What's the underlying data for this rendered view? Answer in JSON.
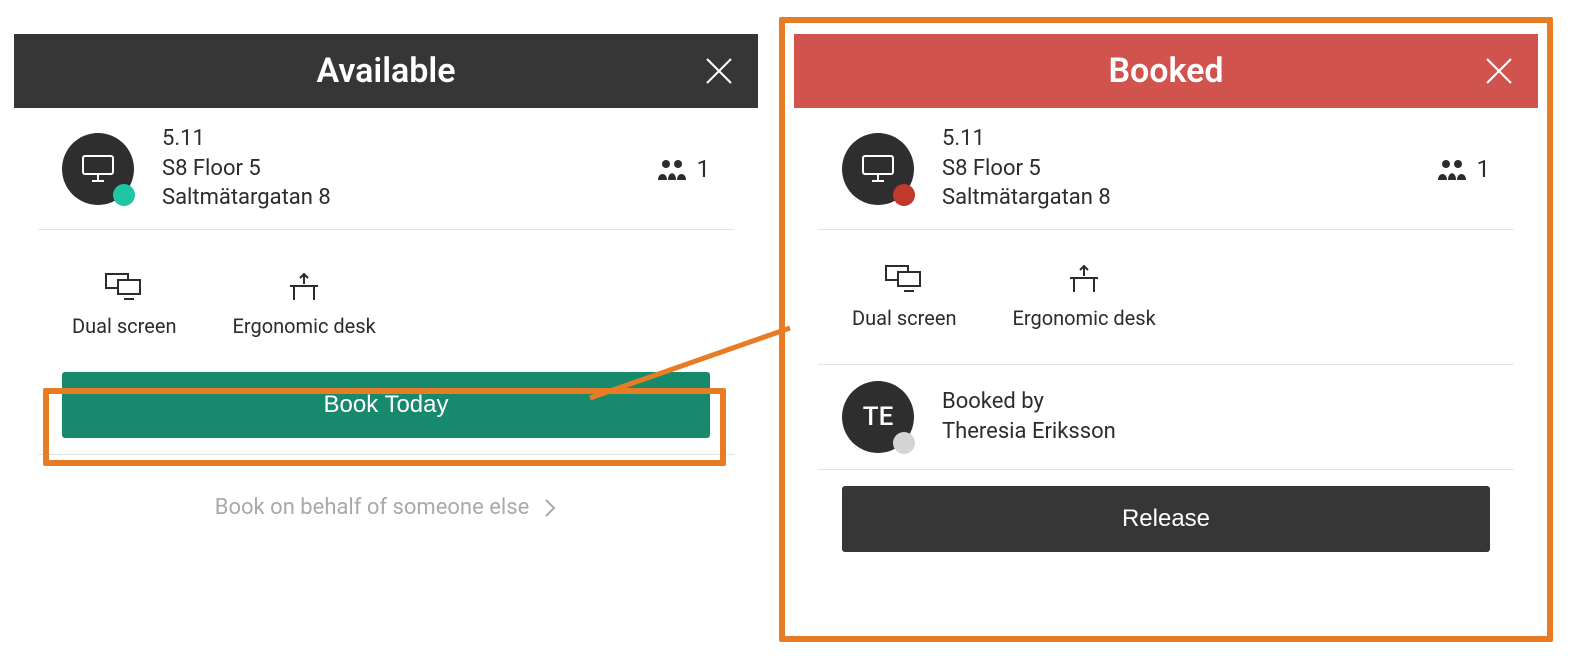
{
  "left": {
    "header": {
      "title": "Available"
    },
    "desk": {
      "name": "5.11",
      "floor": "S8 Floor 5",
      "address": "Saltmätargatan 8",
      "capacity": "1"
    },
    "features": [
      {
        "icon": "dual-screen-icon",
        "label": "Dual screen"
      },
      {
        "icon": "ergonomic-desk-icon",
        "label": "Ergonomic desk"
      }
    ],
    "action_label": "Book Today",
    "secondary_label": "Book on behalf of someone else"
  },
  "right": {
    "header": {
      "title": "Booked"
    },
    "desk": {
      "name": "5.11",
      "floor": "S8 Floor 5",
      "address": "Saltmätargatan 8",
      "capacity": "1"
    },
    "features": [
      {
        "icon": "dual-screen-icon",
        "label": "Dual screen"
      },
      {
        "icon": "ergonomic-desk-icon",
        "label": "Ergonomic desk"
      }
    ],
    "booking": {
      "initials": "TE",
      "booked_by_label": "Booked by",
      "user_name": "Theresia Eriksson"
    },
    "action_label": "Release"
  },
  "colors": {
    "highlight": "#e87c24",
    "header_dark": "#363636",
    "header_red": "#d1534e",
    "btn_green": "#17896d"
  }
}
